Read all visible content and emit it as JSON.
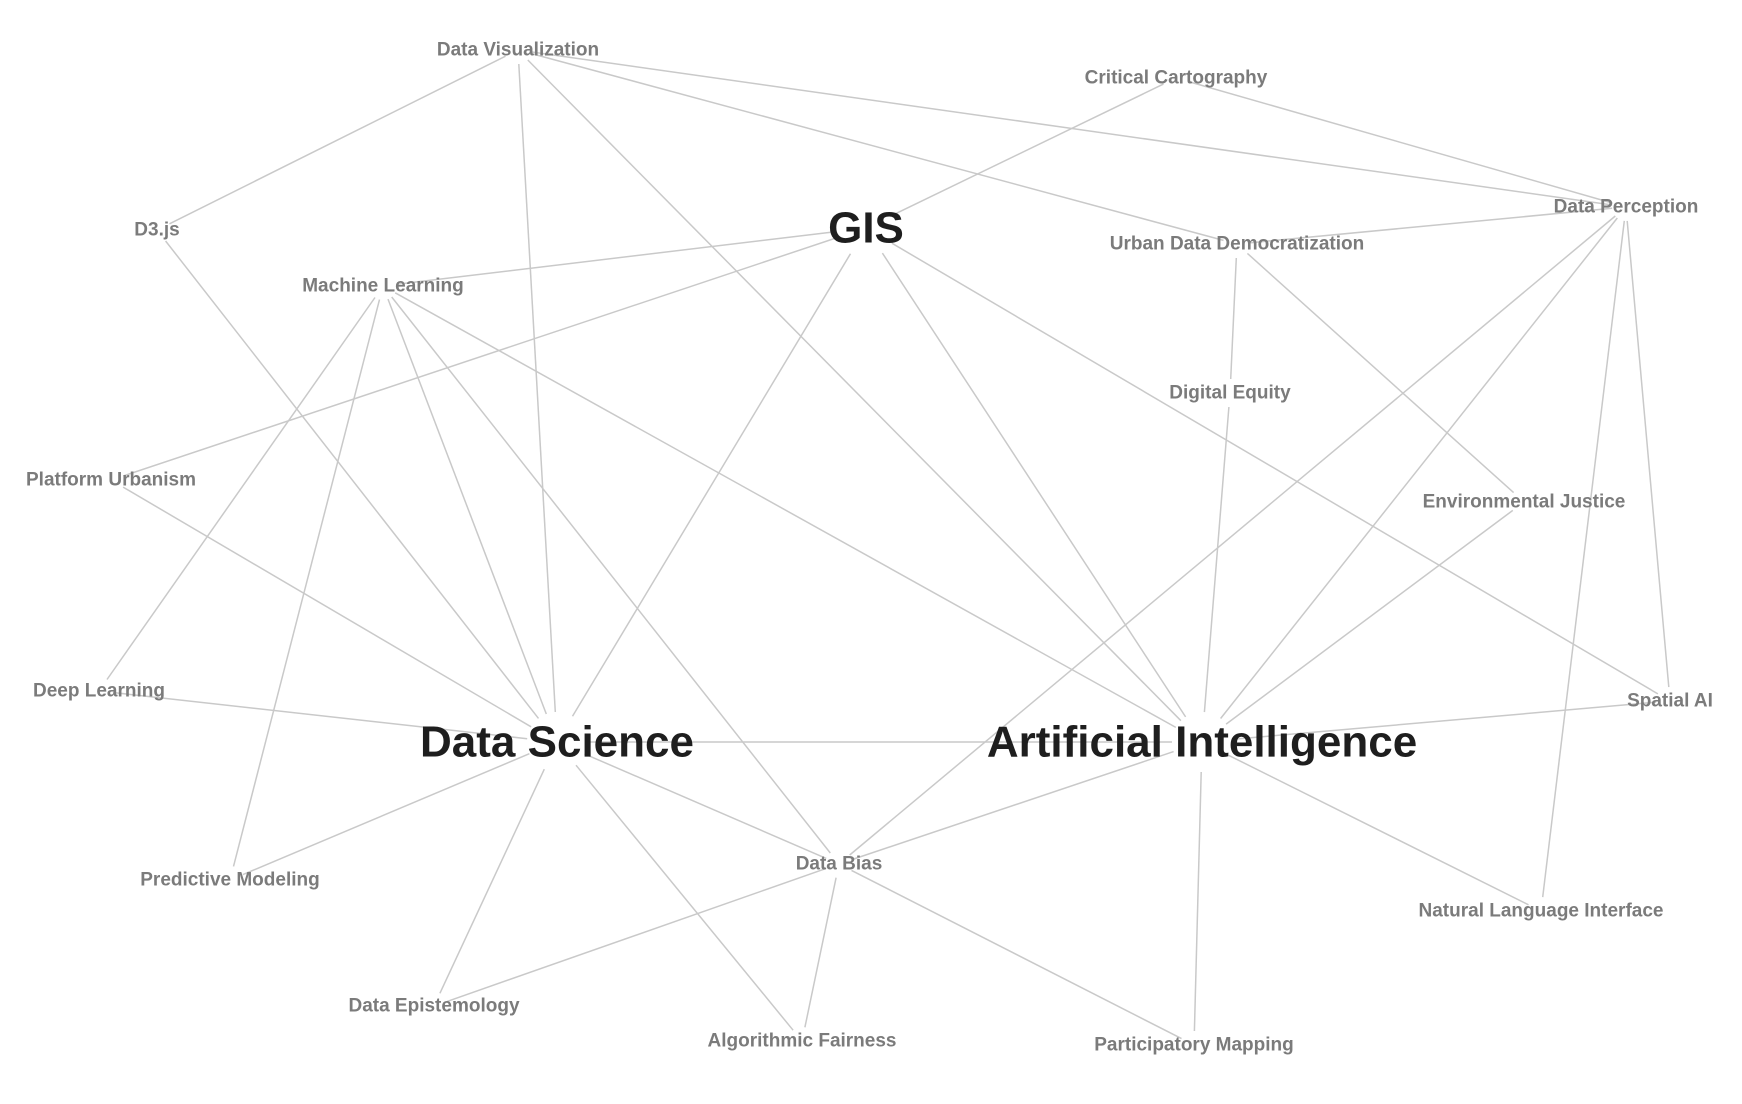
{
  "diagram": {
    "type": "concept-network",
    "colors": {
      "edge": "#c9c9c9",
      "major_label": "#1e1e1e",
      "minor_label": "#7b7b7b",
      "background": "#ffffff"
    },
    "nodes": [
      {
        "id": "gis",
        "label": "GIS",
        "tier": "major"
      },
      {
        "id": "data-science",
        "label": "Data Science",
        "tier": "major"
      },
      {
        "id": "artificial-intelligence",
        "label": "Artificial Intelligence",
        "tier": "major"
      },
      {
        "id": "data-visualization",
        "label": "Data Visualization",
        "tier": "minor"
      },
      {
        "id": "critical-cartography",
        "label": "Critical Cartography",
        "tier": "minor"
      },
      {
        "id": "data-perception",
        "label": "Data Perception",
        "tier": "minor"
      },
      {
        "id": "d3js",
        "label": "D3.js",
        "tier": "minor"
      },
      {
        "id": "urban-data-democratization",
        "label": "Urban Data Democratization",
        "tier": "minor"
      },
      {
        "id": "machine-learning",
        "label": "Machine Learning",
        "tier": "minor"
      },
      {
        "id": "digital-equity",
        "label": "Digital Equity",
        "tier": "minor"
      },
      {
        "id": "platform-urbanism",
        "label": "Platform Urbanism",
        "tier": "minor"
      },
      {
        "id": "environmental-justice",
        "label": "Environmental Justice",
        "tier": "minor"
      },
      {
        "id": "deep-learning",
        "label": "Deep Learning",
        "tier": "minor"
      },
      {
        "id": "spatial-ai",
        "label": "Spatial AI",
        "tier": "minor"
      },
      {
        "id": "data-bias",
        "label": "Data Bias",
        "tier": "minor"
      },
      {
        "id": "predictive-modeling",
        "label": "Predictive Modeling",
        "tier": "minor"
      },
      {
        "id": "natural-language-interface",
        "label": "Natural Language Interface",
        "tier": "minor"
      },
      {
        "id": "data-epistemology",
        "label": "Data Epistemology",
        "tier": "minor"
      },
      {
        "id": "algorithmic-fairness",
        "label": "Algorithmic Fairness",
        "tier": "minor"
      },
      {
        "id": "participatory-mapping",
        "label": "Participatory Mapping",
        "tier": "minor"
      }
    ],
    "edges": [
      [
        "data-visualization",
        "d3js"
      ],
      [
        "data-visualization",
        "data-science"
      ],
      [
        "data-visualization",
        "artificial-intelligence"
      ],
      [
        "data-visualization",
        "urban-data-democratization"
      ],
      [
        "data-visualization",
        "data-perception"
      ],
      [
        "critical-cartography",
        "gis"
      ],
      [
        "critical-cartography",
        "data-perception"
      ],
      [
        "d3js",
        "data-science"
      ],
      [
        "gis",
        "machine-learning"
      ],
      [
        "gis",
        "platform-urbanism"
      ],
      [
        "gis",
        "data-science"
      ],
      [
        "gis",
        "artificial-intelligence"
      ],
      [
        "gis",
        "spatial-ai"
      ],
      [
        "urban-data-democratization",
        "data-perception"
      ],
      [
        "urban-data-democratization",
        "digital-equity"
      ],
      [
        "urban-data-democratization",
        "environmental-justice"
      ],
      [
        "data-perception",
        "data-bias"
      ],
      [
        "data-perception",
        "artificial-intelligence"
      ],
      [
        "data-perception",
        "spatial-ai"
      ],
      [
        "data-perception",
        "natural-language-interface"
      ],
      [
        "machine-learning",
        "deep-learning"
      ],
      [
        "machine-learning",
        "predictive-modeling"
      ],
      [
        "machine-learning",
        "data-science"
      ],
      [
        "machine-learning",
        "data-bias"
      ],
      [
        "machine-learning",
        "artificial-intelligence"
      ],
      [
        "platform-urbanism",
        "data-science"
      ],
      [
        "digital-equity",
        "artificial-intelligence"
      ],
      [
        "environmental-justice",
        "artificial-intelligence"
      ],
      [
        "deep-learning",
        "data-science"
      ],
      [
        "data-science",
        "artificial-intelligence"
      ],
      [
        "data-science",
        "predictive-modeling"
      ],
      [
        "data-science",
        "data-epistemology"
      ],
      [
        "data-science",
        "algorithmic-fairness"
      ],
      [
        "data-science",
        "data-bias"
      ],
      [
        "artificial-intelligence",
        "spatial-ai"
      ],
      [
        "artificial-intelligence",
        "data-bias"
      ],
      [
        "artificial-intelligence",
        "natural-language-interface"
      ],
      [
        "artificial-intelligence",
        "participatory-mapping"
      ],
      [
        "data-bias",
        "data-epistemology"
      ],
      [
        "data-bias",
        "algorithmic-fairness"
      ],
      [
        "data-bias",
        "participatory-mapping"
      ]
    ]
  }
}
